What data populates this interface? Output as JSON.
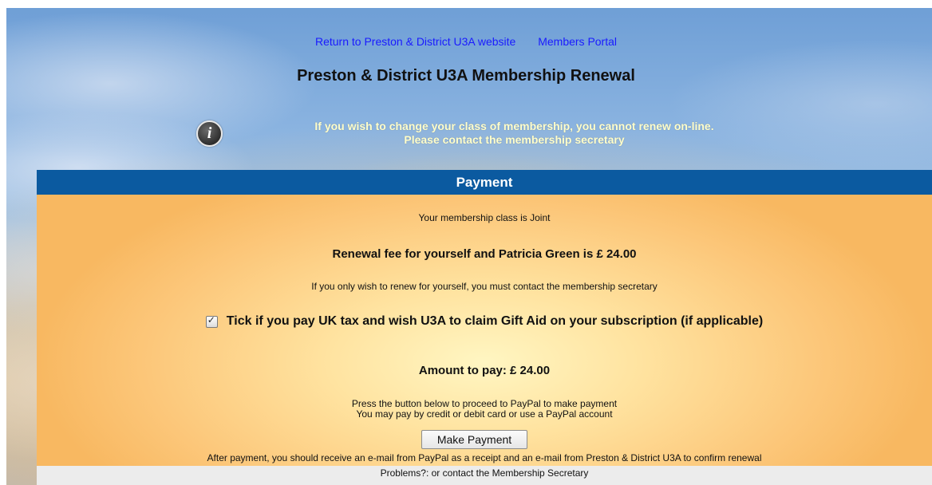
{
  "links": {
    "website": "Return to Preston & District U3A website",
    "portal": "Members Portal"
  },
  "page_title": "Preston & District U3A Membership Renewal",
  "notice": {
    "icon": "info-icon",
    "line1": "If you wish to change your class of membership, you cannot renew on-line.",
    "line2": "Please contact the membership secretary"
  },
  "payment": {
    "header": "Payment",
    "membership_class": "Your membership class is Joint",
    "renewal_fee": "Renewal fee for yourself and Patricia Green is £ 24.00",
    "self_only": "If you only wish to renew for yourself, you must contact the membership secretary",
    "gift_aid_checked": true,
    "gift_aid_label": "Tick if you pay UK tax and wish U3A to claim Gift Aid on your subscription (if applicable)",
    "amount_to_pay": "Amount to pay: £ 24.00",
    "paypal_line1": "Press the button below to proceed to PayPal to make payment",
    "paypal_line2": "You may pay by credit or debit card or use a PayPal account",
    "button_label": "Make Payment",
    "after_payment": "After payment, you should receive an e-mail from PayPal as a receipt and an e-mail from Preston & District U3A to confirm renewal"
  },
  "footer": {
    "problems": "Problems?: or contact the Membership Secretary"
  },
  "colors": {
    "link": "#1a1aff",
    "header_bar": "#0b5aa0",
    "notice_text": "#ffffcc"
  }
}
